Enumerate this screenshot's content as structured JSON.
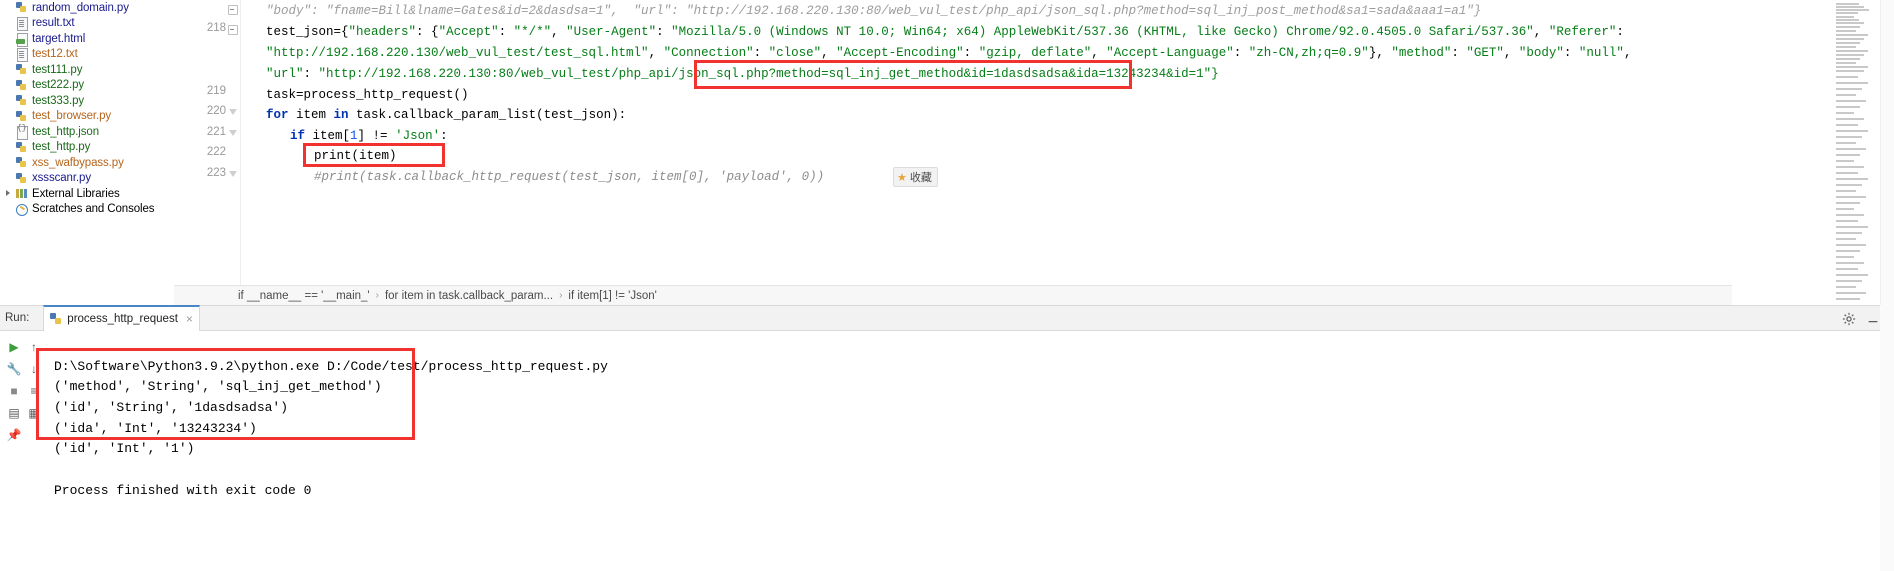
{
  "project_tree": {
    "items": [
      {
        "label": "random_domain.py",
        "icon": "python-file-icon",
        "color": "#1a1a8c",
        "indent": 0,
        "expandable": false
      },
      {
        "label": "result.txt",
        "icon": "text-file-icon",
        "color": "#1a1a8c",
        "indent": 0,
        "expandable": false
      },
      {
        "label": "target.html",
        "icon": "html-file-icon",
        "color": "#1a1a8c",
        "indent": 0,
        "expandable": false
      },
      {
        "label": "test12.txt",
        "icon": "text-file-icon",
        "color": "#b5651d",
        "indent": 0,
        "expandable": false
      },
      {
        "label": "test111.py",
        "icon": "python-file-icon",
        "color": "#1a6a1a",
        "indent": 0,
        "expandable": false
      },
      {
        "label": "test222.py",
        "icon": "python-file-icon",
        "color": "#1a6a1a",
        "indent": 0,
        "expandable": false
      },
      {
        "label": "test333.py",
        "icon": "python-file-icon",
        "color": "#1a6a1a",
        "indent": 0,
        "expandable": false
      },
      {
        "label": "test_browser.py",
        "icon": "python-file-icon",
        "color": "#b5651d",
        "indent": 0,
        "expandable": false
      },
      {
        "label": "test_http.json",
        "icon": "json-file-icon",
        "color": "#1a6a1a",
        "indent": 0,
        "expandable": false
      },
      {
        "label": "test_http.py",
        "icon": "python-file-icon",
        "color": "#1a6a1a",
        "indent": 0,
        "expandable": false
      },
      {
        "label": "xss_wafbypass.py",
        "icon": "python-file-icon",
        "color": "#b5651d",
        "indent": 0,
        "expandable": false
      },
      {
        "label": "xssscanr.py",
        "icon": "python-file-icon",
        "color": "#1a1a8c",
        "indent": 0,
        "expandable": false
      },
      {
        "label": "External Libraries",
        "icon": "libraries-icon",
        "color": "#000000",
        "indent": 0,
        "expandable": true
      },
      {
        "label": "Scratches and Consoles",
        "icon": "scratches-icon",
        "color": "#000000",
        "indent": 0,
        "expandable": false
      }
    ]
  },
  "editor": {
    "line_numbers": [
      "218",
      "219",
      "220",
      "221",
      "222",
      "223"
    ],
    "ghost_line": "\"body\": \"fname=Bill&lname=Gates&id=2&dasdsa=1\",  \"url\": \"http://192.168.220.130:80/web_vul_test/php_api/json_sql.php?method=sql_inj_post_method&sa1=sada&aaa1=a1\"}",
    "lines": [
      {
        "number": "218",
        "segments": [
          {
            "text": "test_json=",
            "type": "plain"
          },
          {
            "text": "{",
            "type": "plain"
          },
          {
            "text": "\"headers\"",
            "type": "string"
          },
          {
            "text": ": {",
            "type": "plain"
          },
          {
            "text": "\"Accept\"",
            "type": "string"
          },
          {
            "text": ": ",
            "type": "plain"
          },
          {
            "text": "\"*/*\"",
            "type": "string"
          },
          {
            "text": ", ",
            "type": "plain"
          },
          {
            "text": "\"User-Agent\"",
            "type": "string"
          },
          {
            "text": ": ",
            "type": "plain"
          },
          {
            "text": "\"Mozilla/5.0 (Windows NT 10.0; Win64; x64) AppleWebKit/537.36 (KHTML, like Gecko) Chrome/92.0.4505.0 Safari/537.36\"",
            "type": "string"
          },
          {
            "text": ", ",
            "type": "plain"
          },
          {
            "text": "\"Referer\"",
            "type": "string"
          },
          {
            "text": ":",
            "type": "plain"
          }
        ]
      },
      {
        "number": "",
        "segments": [
          {
            "text": "\"http://192.168.220.130/web_vul_test/test_sql.html\"",
            "type": "string"
          },
          {
            "text": ", ",
            "type": "plain"
          },
          {
            "text": "\"Connection\"",
            "type": "string"
          },
          {
            "text": ": ",
            "type": "plain"
          },
          {
            "text": "\"close\"",
            "type": "string"
          },
          {
            "text": ", ",
            "type": "plain"
          },
          {
            "text": "\"Accept-Encoding\"",
            "type": "string"
          },
          {
            "text": ": ",
            "type": "plain"
          },
          {
            "text": "\"gzip, deflate\"",
            "type": "string"
          },
          {
            "text": ", ",
            "type": "plain"
          },
          {
            "text": "\"Accept-Language\"",
            "type": "string"
          },
          {
            "text": ": ",
            "type": "plain"
          },
          {
            "text": "\"zh-CN,zh;q=0.9\"",
            "type": "string"
          },
          {
            "text": "}, ",
            "type": "plain"
          },
          {
            "text": "\"method\"",
            "type": "string"
          },
          {
            "text": ": ",
            "type": "plain"
          },
          {
            "text": "\"GET\"",
            "type": "string"
          },
          {
            "text": ", ",
            "type": "plain"
          },
          {
            "text": "\"body\"",
            "type": "string"
          },
          {
            "text": ": ",
            "type": "plain"
          },
          {
            "text": "\"null\"",
            "type": "string"
          },
          {
            "text": ",",
            "type": "plain"
          }
        ]
      },
      {
        "number": "",
        "segments": [
          {
            "text": "\"url\"",
            "type": "string"
          },
          {
            "text": ": ",
            "type": "plain"
          },
          {
            "text": "\"http://192.168.220.130:80/web_vul_test/php_api/json_sql.php?method=sql_inj_get_method&id=1dasdsadsa&ida=13243234&id=1\"}",
            "type": "string"
          }
        ]
      },
      {
        "number": "219",
        "segments": [
          {
            "text": "task=process_http_request()",
            "type": "plain"
          }
        ]
      },
      {
        "number": "220",
        "segments": [
          {
            "text": "for",
            "type": "keyword"
          },
          {
            "text": " item ",
            "type": "plain"
          },
          {
            "text": "in",
            "type": "keyword"
          },
          {
            "text": " task.callback_param_list(test_json):",
            "type": "plain"
          }
        ]
      },
      {
        "number": "221",
        "segments": [
          {
            "text": "if",
            "type": "keyword"
          },
          {
            "text": " item[",
            "type": "plain"
          },
          {
            "text": "1",
            "type": "number"
          },
          {
            "text": "] != ",
            "type": "plain"
          },
          {
            "text": "'Json'",
            "type": "string"
          },
          {
            "text": ":",
            "type": "plain"
          }
        ]
      },
      {
        "number": "222",
        "segments": [
          {
            "text": "print(item)",
            "type": "plain"
          }
        ]
      },
      {
        "number": "223",
        "segments": [
          {
            "text": "#print(task.callback_http_request(test_json, item[0], 'payload', 0))",
            "type": "comment"
          }
        ]
      }
    ],
    "favorite_badge": {
      "label": "收藏",
      "icon": "star-icon"
    },
    "breadcrumbs": [
      "if __name__ == '__main_'",
      "for item in task.callback_param...",
      "if item[1] != 'Json'"
    ],
    "breadcrumb_separator": "›"
  },
  "annotations": {
    "color": "#f2322e",
    "boxes": [
      {
        "name": "url-query-highlight"
      },
      {
        "name": "print-statement-highlight"
      },
      {
        "name": "console-output-highlight"
      }
    ]
  },
  "run_panel": {
    "label": "Run:",
    "tab": {
      "label": "process_http_request",
      "icon": "python-file-icon",
      "close": "×"
    },
    "gear_icon": "gear-icon",
    "minimize_icon": "minimize-icon",
    "toolbar": [
      {
        "name": "run-button",
        "glyph": "▶",
        "color": "#3a9e3a"
      },
      {
        "name": "scroll-up-button",
        "glyph": "↑",
        "color": "#5a5a5a"
      },
      {
        "name": "wrench-button",
        "glyph": "🔧",
        "color": "#5a5a5a"
      },
      {
        "name": "scroll-down-button",
        "glyph": "↓",
        "color": "#5a5a5a"
      },
      {
        "name": "stop-button",
        "glyph": "■",
        "color": "#8a8a8a"
      },
      {
        "name": "soft-wrap-button",
        "glyph": "≡",
        "color": "#5a5a5a"
      },
      {
        "name": "print-button",
        "glyph": "▤",
        "color": "#5a5a5a"
      },
      {
        "name": "trash-button",
        "glyph": "▦",
        "color": "#5a5a5a"
      },
      {
        "name": "pin-button",
        "glyph": "📌",
        "color": "#5a5a5a"
      }
    ],
    "console_lines": [
      "D:\\Software\\Python3.9.2\\python.exe D:/Code/test/process_http_request.py",
      "('method', 'String', 'sql_inj_get_method')",
      "('id', 'String', '1dasdsadsa')",
      "('ida', 'Int', '13243234')",
      "('id', 'Int', '1')",
      "",
      "Process finished with exit code 0"
    ]
  }
}
